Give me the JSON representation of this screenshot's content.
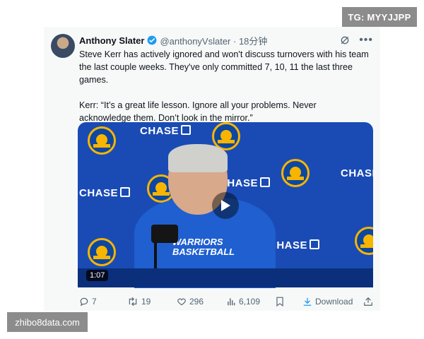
{
  "overlay": {
    "tg_label": "TG: MYYJJPP",
    "watermark": "zhibo8data.com"
  },
  "tweet": {
    "author_name": "Anthony Slater",
    "handle_time": "@anthonyVslater · 18分钟",
    "paragraph_1": "Steve Kerr has actively ignored and won't discuss turnovers with his team the last couple weeks. They've only committed 7, 10, 11 the last three games.",
    "paragraph_2": "Kerr: “It’s a great life lesson. Ignore all your problems. Never acknowledge them. Don’t look in the mirror.”",
    "verified_color": "#1d9bf0",
    "more_icon": "more-icon",
    "grok_icon": "grok-icon"
  },
  "media": {
    "duration": "1:07",
    "wall_text": [
      "CHASE",
      "CHASE",
      "CHASE",
      "CHASE",
      "CHASE"
    ],
    "shirt_text": [
      "WARRIORS",
      "BASKETBALL"
    ],
    "background_color": "#1a4bb5"
  },
  "actions": {
    "replies": "7",
    "reposts": "19",
    "likes": "296",
    "views": "6,109",
    "download_label": "Download"
  }
}
